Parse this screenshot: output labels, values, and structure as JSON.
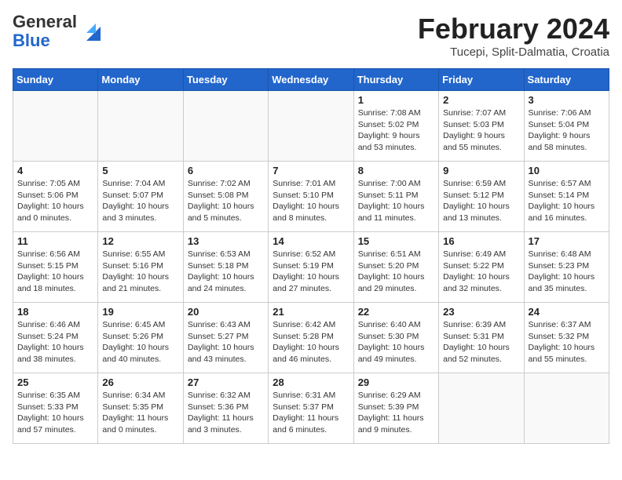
{
  "header": {
    "logo_line1": "General",
    "logo_line2": "Blue",
    "month_title": "February 2024",
    "location": "Tucepi, Split-Dalmatia, Croatia"
  },
  "weekdays": [
    "Sunday",
    "Monday",
    "Tuesday",
    "Wednesday",
    "Thursday",
    "Friday",
    "Saturday"
  ],
  "weeks": [
    [
      {
        "num": "",
        "info": ""
      },
      {
        "num": "",
        "info": ""
      },
      {
        "num": "",
        "info": ""
      },
      {
        "num": "",
        "info": ""
      },
      {
        "num": "1",
        "info": "Sunrise: 7:08 AM\nSunset: 5:02 PM\nDaylight: 9 hours\nand 53 minutes."
      },
      {
        "num": "2",
        "info": "Sunrise: 7:07 AM\nSunset: 5:03 PM\nDaylight: 9 hours\nand 55 minutes."
      },
      {
        "num": "3",
        "info": "Sunrise: 7:06 AM\nSunset: 5:04 PM\nDaylight: 9 hours\nand 58 minutes."
      }
    ],
    [
      {
        "num": "4",
        "info": "Sunrise: 7:05 AM\nSunset: 5:06 PM\nDaylight: 10 hours\nand 0 minutes."
      },
      {
        "num": "5",
        "info": "Sunrise: 7:04 AM\nSunset: 5:07 PM\nDaylight: 10 hours\nand 3 minutes."
      },
      {
        "num": "6",
        "info": "Sunrise: 7:02 AM\nSunset: 5:08 PM\nDaylight: 10 hours\nand 5 minutes."
      },
      {
        "num": "7",
        "info": "Sunrise: 7:01 AM\nSunset: 5:10 PM\nDaylight: 10 hours\nand 8 minutes."
      },
      {
        "num": "8",
        "info": "Sunrise: 7:00 AM\nSunset: 5:11 PM\nDaylight: 10 hours\nand 11 minutes."
      },
      {
        "num": "9",
        "info": "Sunrise: 6:59 AM\nSunset: 5:12 PM\nDaylight: 10 hours\nand 13 minutes."
      },
      {
        "num": "10",
        "info": "Sunrise: 6:57 AM\nSunset: 5:14 PM\nDaylight: 10 hours\nand 16 minutes."
      }
    ],
    [
      {
        "num": "11",
        "info": "Sunrise: 6:56 AM\nSunset: 5:15 PM\nDaylight: 10 hours\nand 18 minutes."
      },
      {
        "num": "12",
        "info": "Sunrise: 6:55 AM\nSunset: 5:16 PM\nDaylight: 10 hours\nand 21 minutes."
      },
      {
        "num": "13",
        "info": "Sunrise: 6:53 AM\nSunset: 5:18 PM\nDaylight: 10 hours\nand 24 minutes."
      },
      {
        "num": "14",
        "info": "Sunrise: 6:52 AM\nSunset: 5:19 PM\nDaylight: 10 hours\nand 27 minutes."
      },
      {
        "num": "15",
        "info": "Sunrise: 6:51 AM\nSunset: 5:20 PM\nDaylight: 10 hours\nand 29 minutes."
      },
      {
        "num": "16",
        "info": "Sunrise: 6:49 AM\nSunset: 5:22 PM\nDaylight: 10 hours\nand 32 minutes."
      },
      {
        "num": "17",
        "info": "Sunrise: 6:48 AM\nSunset: 5:23 PM\nDaylight: 10 hours\nand 35 minutes."
      }
    ],
    [
      {
        "num": "18",
        "info": "Sunrise: 6:46 AM\nSunset: 5:24 PM\nDaylight: 10 hours\nand 38 minutes."
      },
      {
        "num": "19",
        "info": "Sunrise: 6:45 AM\nSunset: 5:26 PM\nDaylight: 10 hours\nand 40 minutes."
      },
      {
        "num": "20",
        "info": "Sunrise: 6:43 AM\nSunset: 5:27 PM\nDaylight: 10 hours\nand 43 minutes."
      },
      {
        "num": "21",
        "info": "Sunrise: 6:42 AM\nSunset: 5:28 PM\nDaylight: 10 hours\nand 46 minutes."
      },
      {
        "num": "22",
        "info": "Sunrise: 6:40 AM\nSunset: 5:30 PM\nDaylight: 10 hours\nand 49 minutes."
      },
      {
        "num": "23",
        "info": "Sunrise: 6:39 AM\nSunset: 5:31 PM\nDaylight: 10 hours\nand 52 minutes."
      },
      {
        "num": "24",
        "info": "Sunrise: 6:37 AM\nSunset: 5:32 PM\nDaylight: 10 hours\nand 55 minutes."
      }
    ],
    [
      {
        "num": "25",
        "info": "Sunrise: 6:35 AM\nSunset: 5:33 PM\nDaylight: 10 hours\nand 57 minutes."
      },
      {
        "num": "26",
        "info": "Sunrise: 6:34 AM\nSunset: 5:35 PM\nDaylight: 11 hours\nand 0 minutes."
      },
      {
        "num": "27",
        "info": "Sunrise: 6:32 AM\nSunset: 5:36 PM\nDaylight: 11 hours\nand 3 minutes."
      },
      {
        "num": "28",
        "info": "Sunrise: 6:31 AM\nSunset: 5:37 PM\nDaylight: 11 hours\nand 6 minutes."
      },
      {
        "num": "29",
        "info": "Sunrise: 6:29 AM\nSunset: 5:39 PM\nDaylight: 11 hours\nand 9 minutes."
      },
      {
        "num": "",
        "info": ""
      },
      {
        "num": "",
        "info": ""
      }
    ]
  ]
}
